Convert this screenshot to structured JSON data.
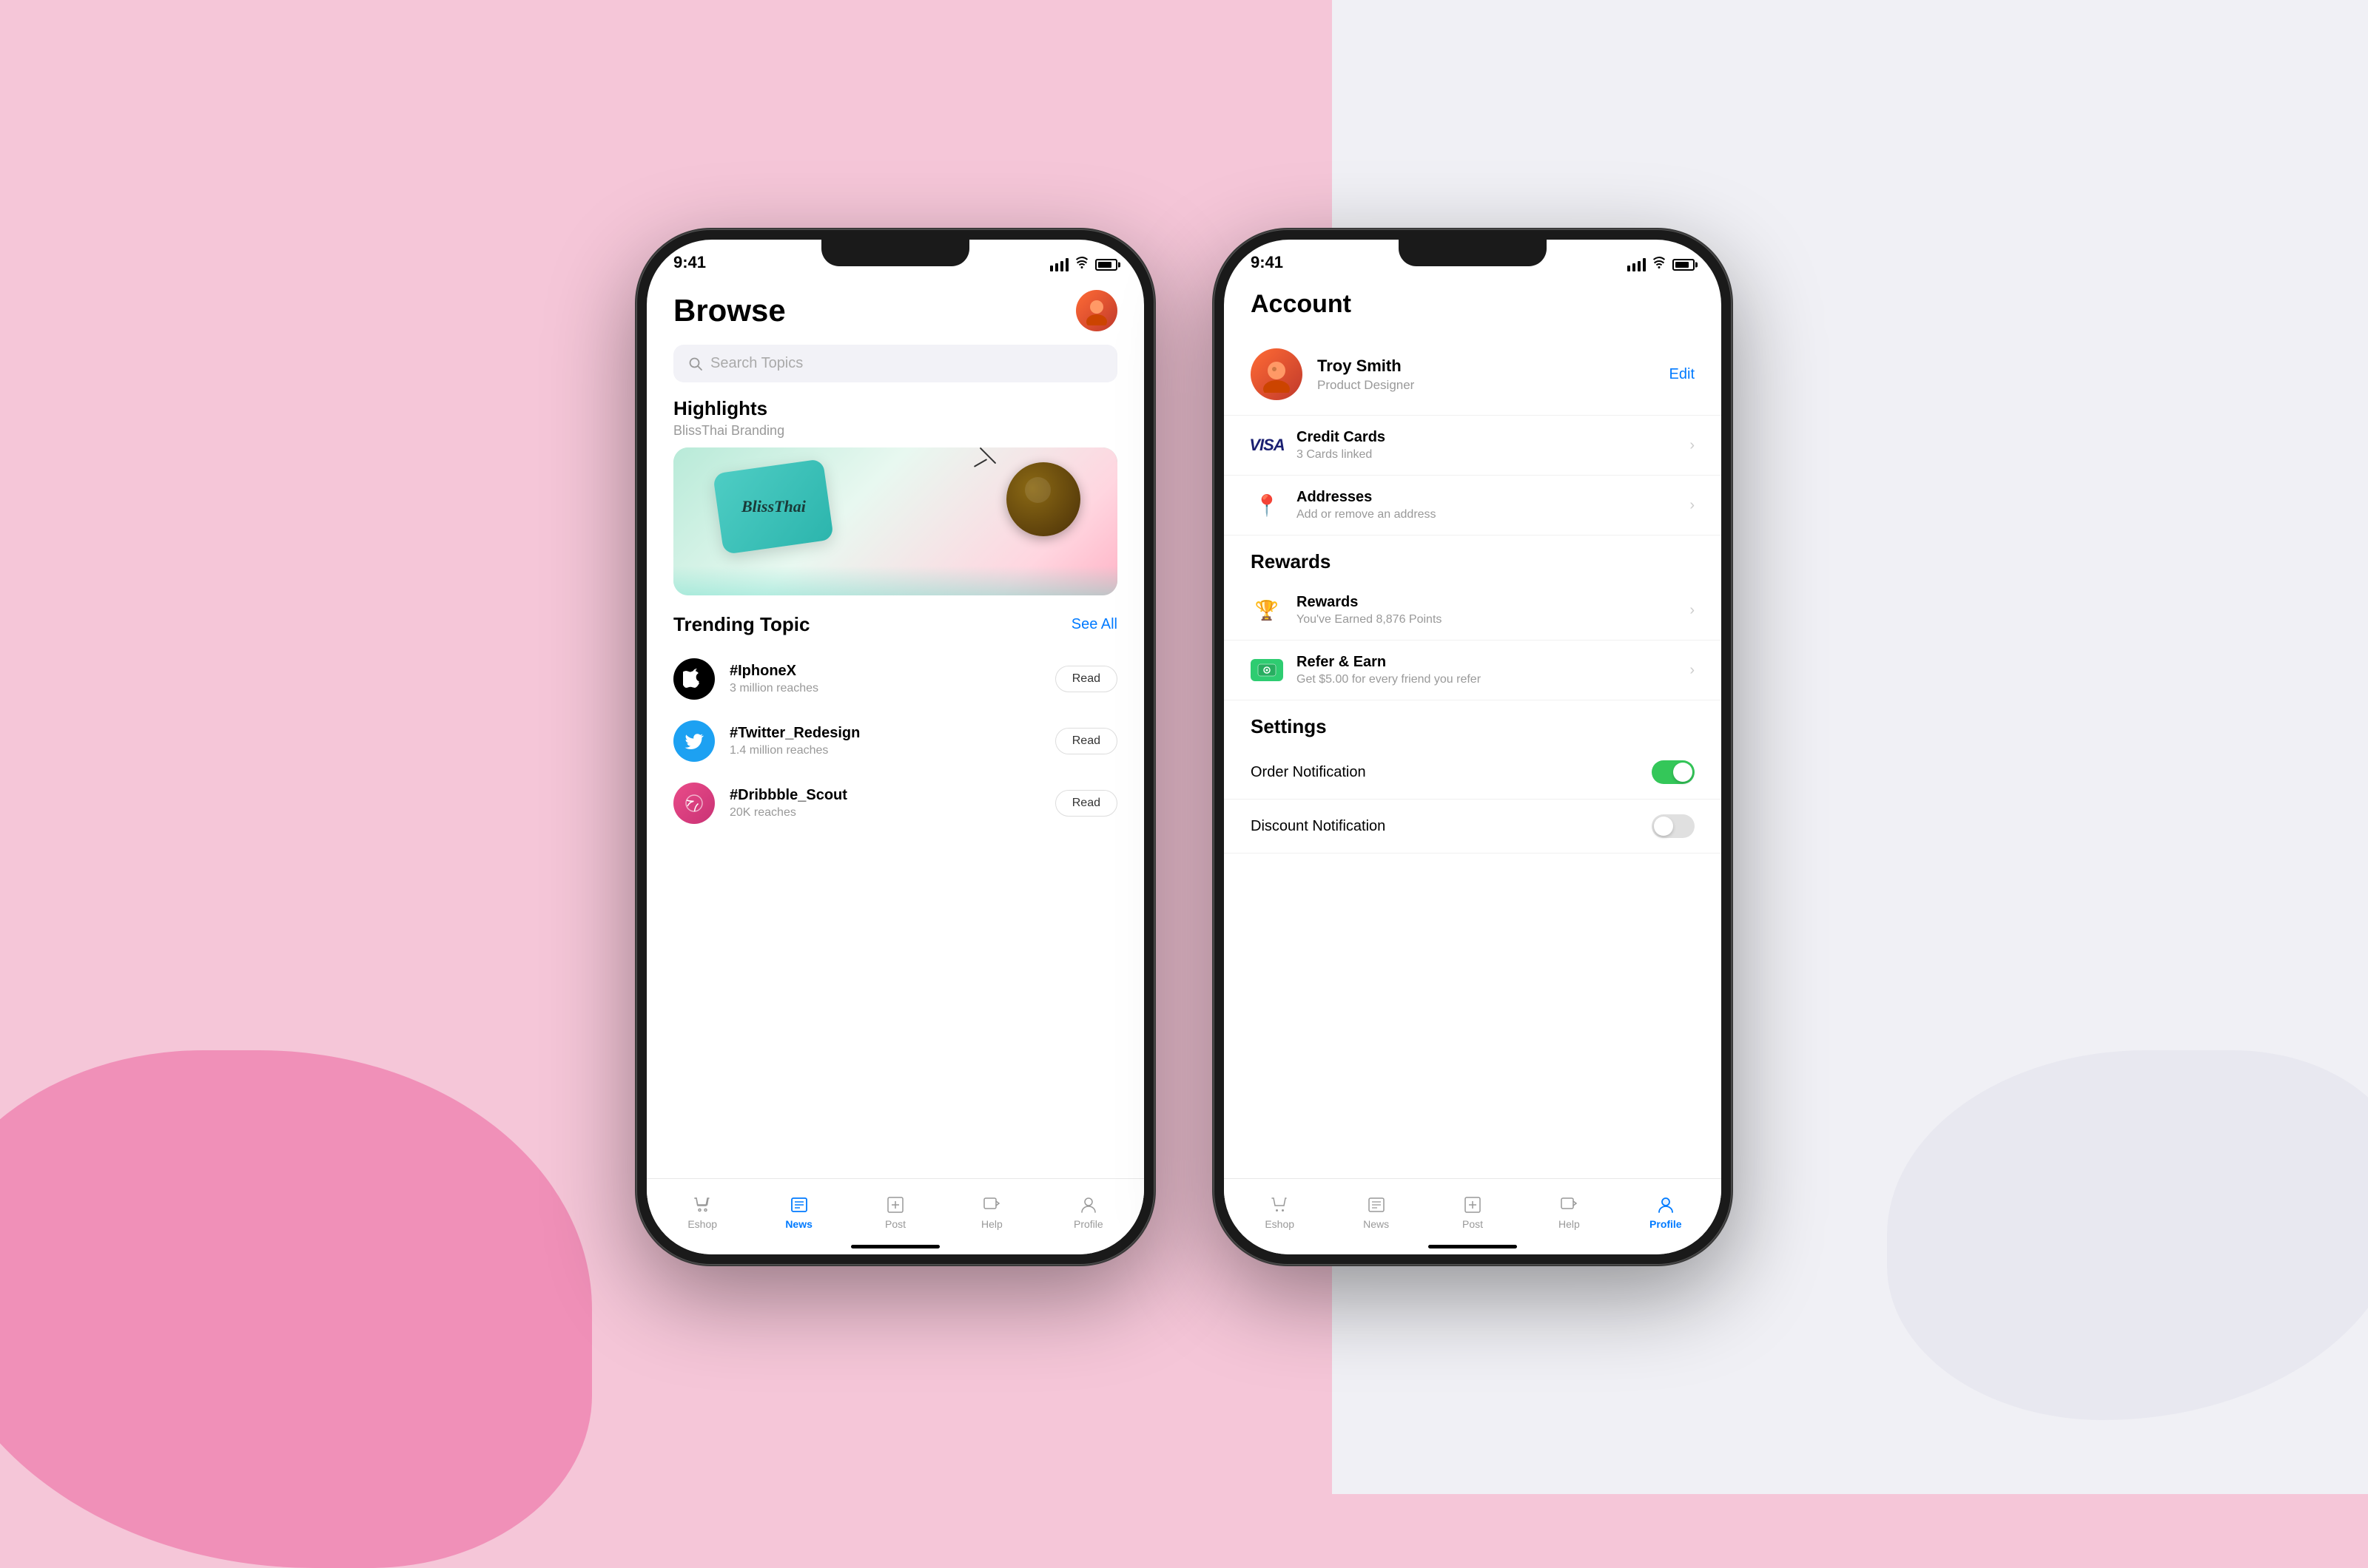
{
  "background": {
    "left_color": "#f5c6d8",
    "right_color": "#f0f0f5"
  },
  "phone_browse": {
    "status_time": "9:41",
    "header_title": "Browse",
    "search_placeholder": "Search Topics",
    "highlights_label": "Highlights",
    "highlights_sub": "BlissThai Branding",
    "bliss_thai_text": "BlissThai",
    "trending_label": "Trending Topic",
    "see_all_label": "See All",
    "trending_items": [
      {
        "name": "#IphoneX",
        "reaches": "3 million reaches",
        "icon_type": "apple",
        "read_label": "Read"
      },
      {
        "name": "#Twitter_Redesign",
        "reaches": "1.4 million reaches",
        "icon_type": "twitter",
        "read_label": "Read"
      },
      {
        "name": "#Dribbble_Scout",
        "reaches": "20K reaches",
        "icon_type": "dribbble",
        "read_label": "Read"
      }
    ],
    "tabs": [
      {
        "label": "Eshop",
        "active": false
      },
      {
        "label": "News",
        "active": true
      },
      {
        "label": "Post",
        "active": false
      },
      {
        "label": "Help",
        "active": false
      },
      {
        "label": "Profile",
        "active": false
      }
    ]
  },
  "phone_account": {
    "status_time": "9:41",
    "header_title": "Account",
    "profile": {
      "name": "Troy Smith",
      "role": "Product Designer",
      "edit_label": "Edit"
    },
    "menu_items": [
      {
        "icon": "visa",
        "title": "Credit Cards",
        "subtitle": "3 Cards linked",
        "has_chevron": true
      },
      {
        "icon": "pin",
        "title": "Addresses",
        "subtitle": "Add or remove an address",
        "has_chevron": true
      }
    ],
    "rewards_section": "Rewards",
    "rewards_items": [
      {
        "icon": "trophy",
        "title": "Rewards",
        "subtitle": "You've Earned 8,876 Points",
        "has_chevron": true
      },
      {
        "icon": "refer",
        "title": "Refer & Earn",
        "subtitle": "Get $5.00 for every friend you refer",
        "has_chevron": true
      }
    ],
    "settings_section": "Settings",
    "settings_items": [
      {
        "label": "Order Notification",
        "toggle_on": true
      },
      {
        "label": "Discount Notification",
        "toggle_on": false
      }
    ],
    "tabs": [
      {
        "label": "Eshop",
        "active": false
      },
      {
        "label": "News",
        "active": false
      },
      {
        "label": "Post",
        "active": false
      },
      {
        "label": "Help",
        "active": false
      },
      {
        "label": "Profile",
        "active": true
      }
    ]
  }
}
